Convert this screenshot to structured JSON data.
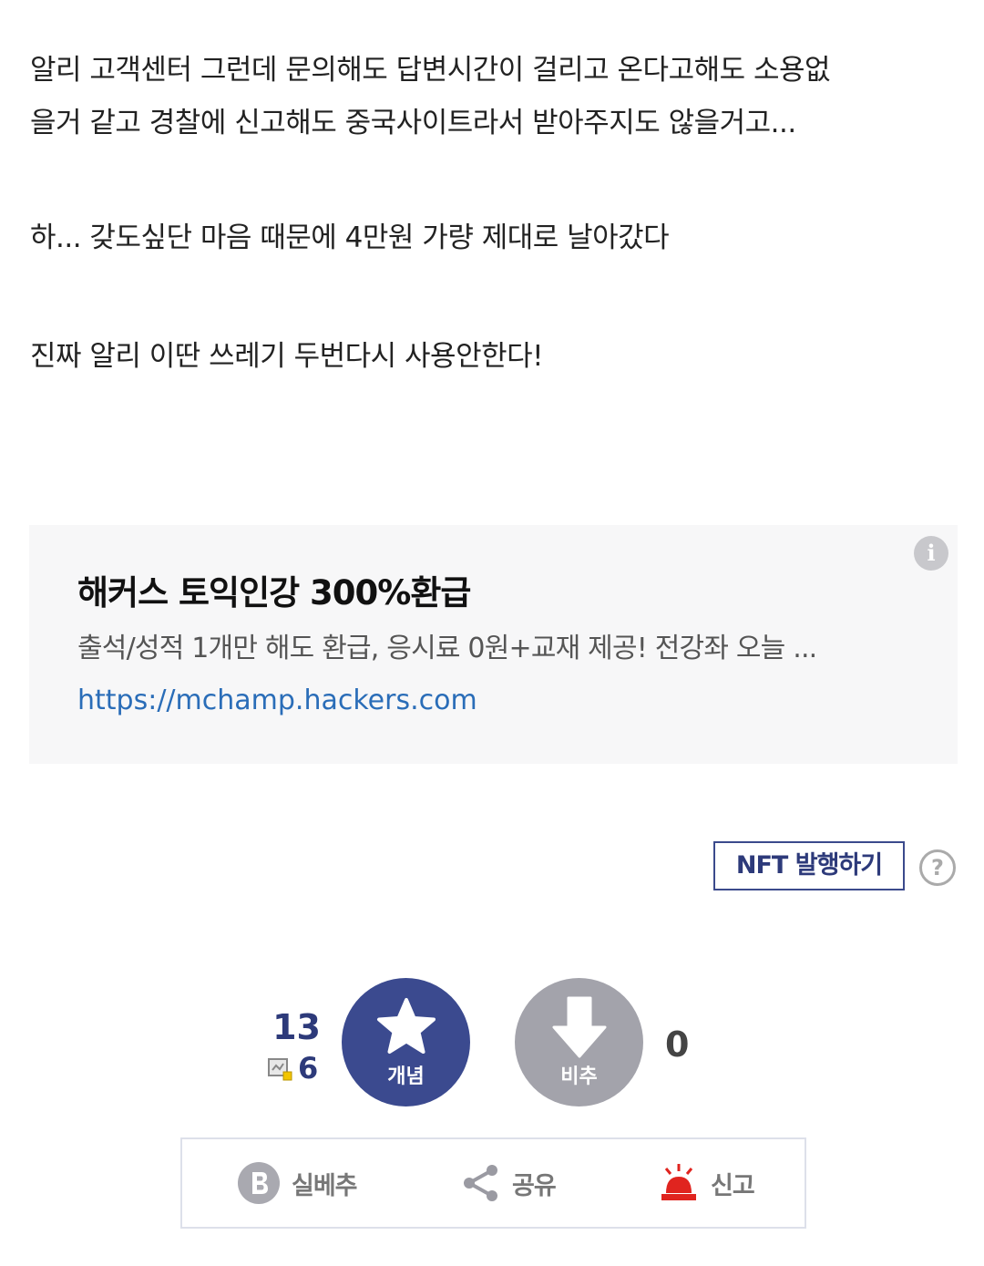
{
  "post": {
    "lines": [
      "알리 고객센터 그런데 문의해도 답변시간이 걸리고 온다고해도 소용없",
      "을거 같고 경찰에 신고해도 중국사이트라서 받아주지도 않을거고...",
      "하... 갖도싶단 마음 때문에 4만원 가량 제대로 날아갔다",
      "진짜 알리 이딴 쓰레기 두번다시 사용안한다!"
    ]
  },
  "ad": {
    "info_icon": "i",
    "title": "해커스 토익인강 300%환급",
    "description": "출석/성적 1개만 해도 환급, 응시료 0원+교재 제공! 전강좌 오늘 ...",
    "url": "https://mchamp.hackers.com"
  },
  "nft": {
    "button_label": "NFT 발행하기",
    "help_icon": "?"
  },
  "votes": {
    "up_count": "13",
    "fix_count": "6",
    "up_label": "개념",
    "down_label": "비추",
    "down_count": "0",
    "up_color": "#3b4a8f",
    "down_color": "#a3a3ab"
  },
  "actions": {
    "silbe_label": "실베추",
    "share_label": "공유",
    "report_label": "신고",
    "report_color": "#e0241f"
  }
}
